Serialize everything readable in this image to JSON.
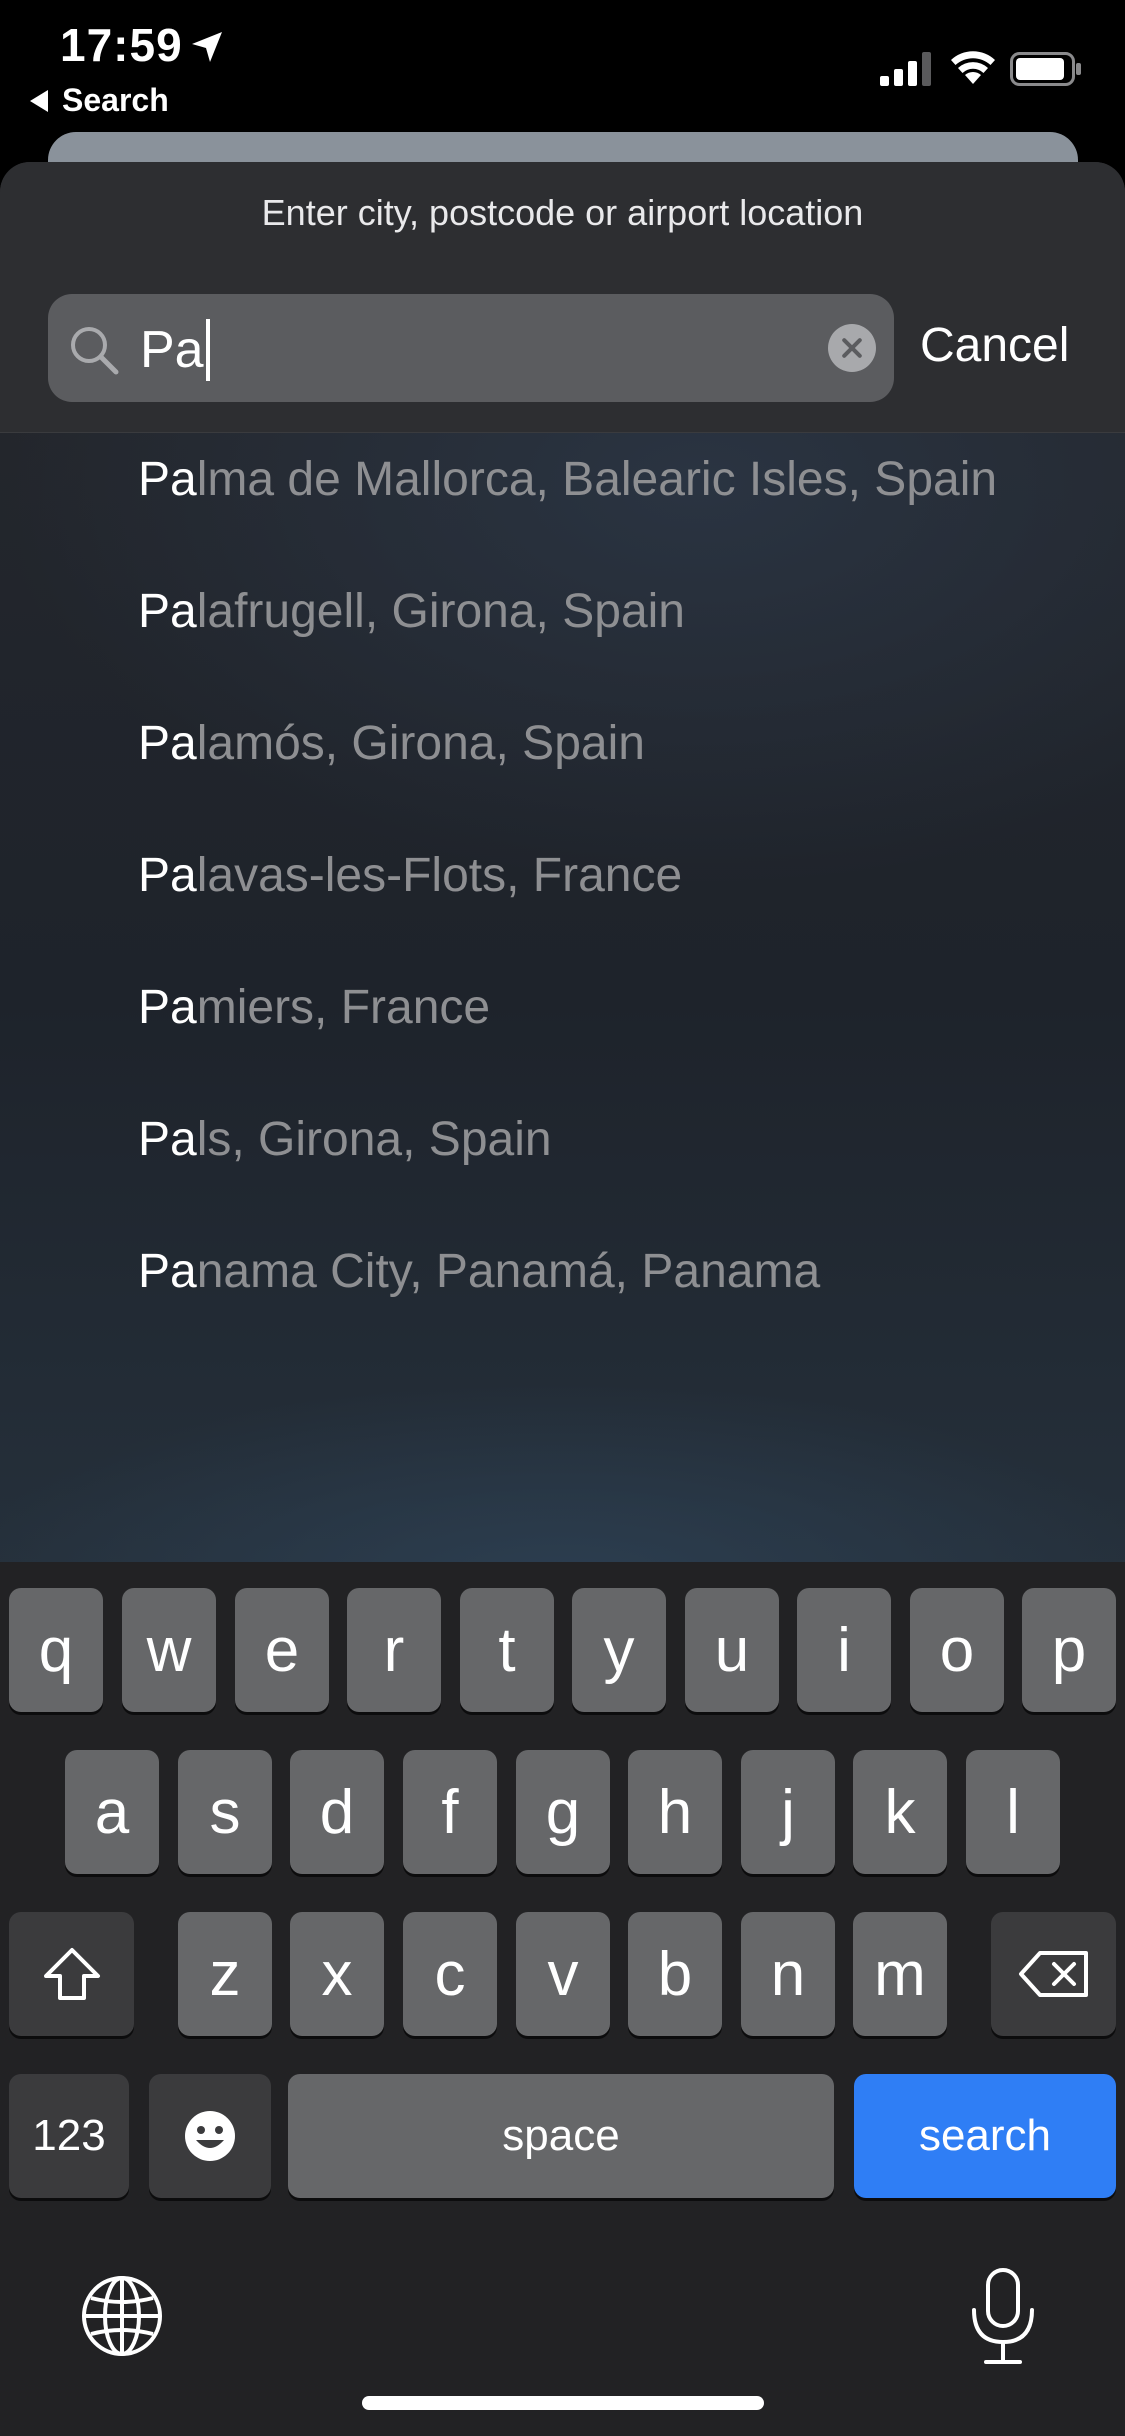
{
  "status_bar": {
    "time": "17:59",
    "back_label": "Search"
  },
  "sheet": {
    "title": "Enter city, postcode or airport location",
    "search": {
      "value": "Pa",
      "cancel_label": "Cancel"
    },
    "results": [
      {
        "highlight": "Pa",
        "rest": "lma de Mallorca, Balearic Isles, Spain"
      },
      {
        "highlight": "Pa",
        "rest": "lafrugell, Girona, Spain"
      },
      {
        "highlight": "Pa",
        "rest": "lamós, Girona, Spain"
      },
      {
        "highlight": "Pa",
        "rest": "lavas-les-Flots, France"
      },
      {
        "highlight": "Pa",
        "rest": "miers, France"
      },
      {
        "highlight": "Pa",
        "rest": "ls, Girona, Spain"
      },
      {
        "highlight": "Pa",
        "rest": "nama City, Panamá, Panama"
      }
    ]
  },
  "keyboard": {
    "row1": [
      "q",
      "w",
      "e",
      "r",
      "t",
      "y",
      "u",
      "i",
      "o",
      "p"
    ],
    "row2": [
      "a",
      "s",
      "d",
      "f",
      "g",
      "h",
      "j",
      "k",
      "l"
    ],
    "row3": [
      "z",
      "x",
      "c",
      "v",
      "b",
      "n",
      "m"
    ],
    "numbers_label": "123",
    "space_label": "space",
    "search_label": "search"
  },
  "colors": {
    "accent": "#2f7ef5",
    "result_highlight": "#ffffff",
    "result_text": "#8e8f92"
  }
}
